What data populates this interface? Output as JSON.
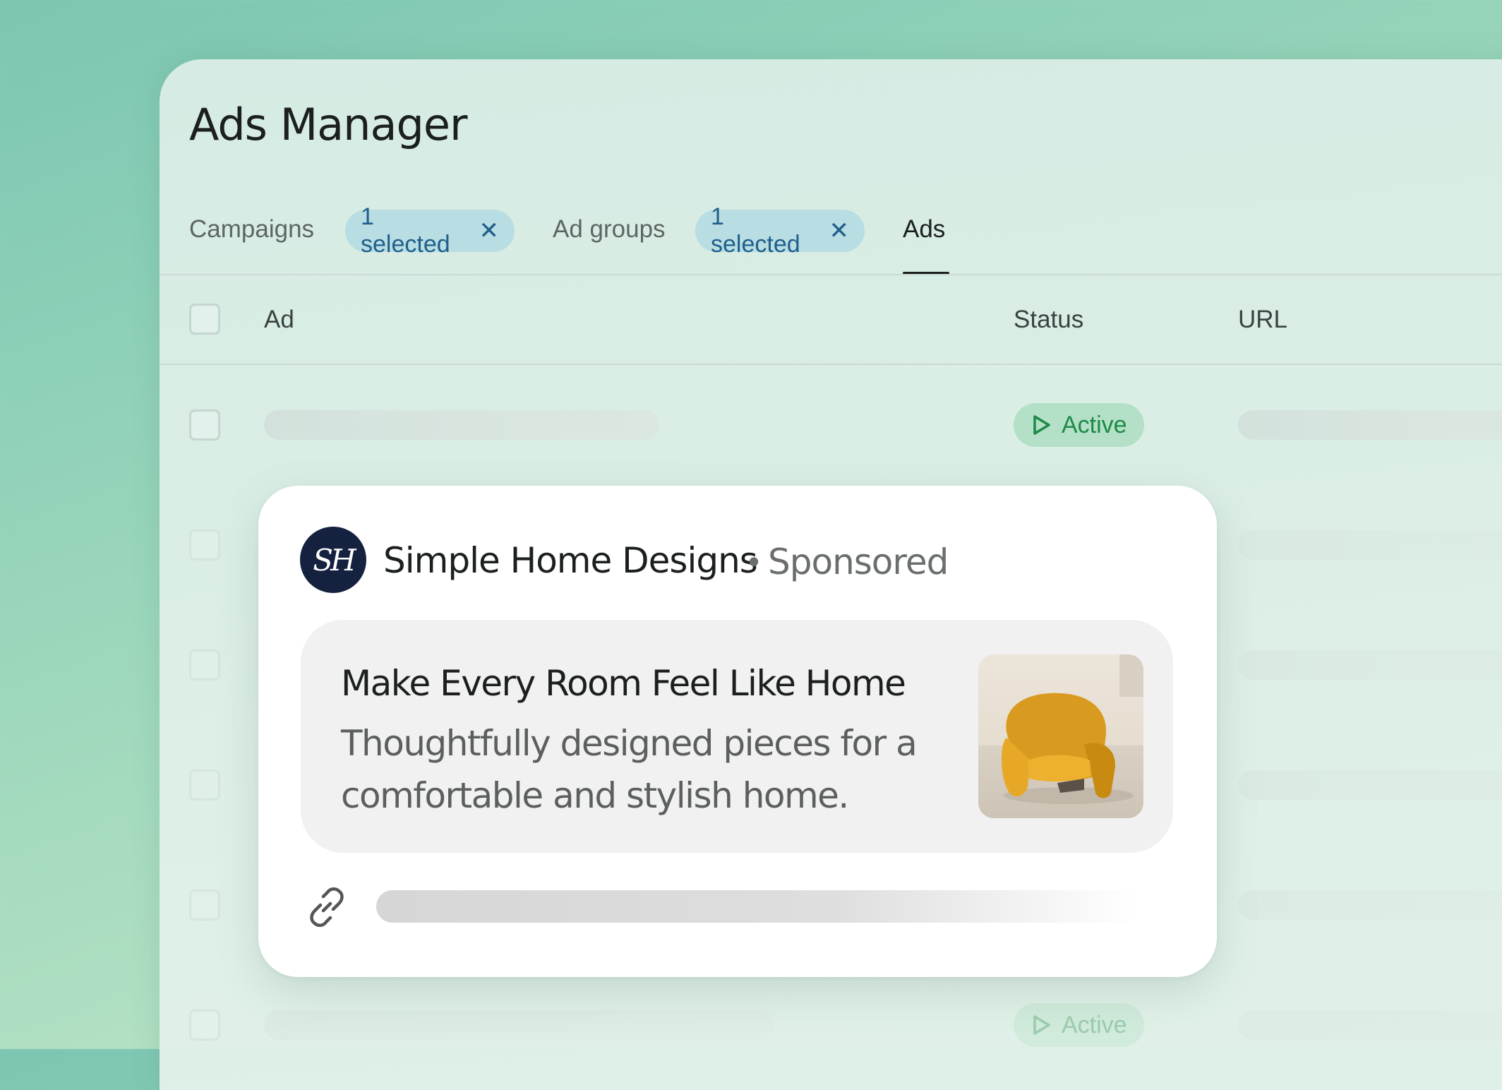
{
  "app": {
    "title": "Ads Manager"
  },
  "tabs": {
    "campaigns": {
      "label": "Campaigns",
      "chip": "1 selected"
    },
    "ad_groups": {
      "label": "Ad groups",
      "chip": "1 selected"
    },
    "ads": {
      "label": "Ads",
      "active": true
    }
  },
  "table": {
    "columns": [
      "Ad",
      "Status",
      "URL"
    ],
    "rows": [
      {
        "status": "Active"
      },
      {
        "status": ""
      },
      {
        "status": ""
      },
      {
        "status": ""
      },
      {
        "status": ""
      },
      {
        "status": "Active"
      }
    ]
  },
  "ad_preview": {
    "advertiser": "Simple Home Designs",
    "separator": "•",
    "sponsored_label": "Sponsored",
    "avatar_initials": "SH",
    "headline": "Make Every Room Feel Like Home",
    "description": "Thoughtfully designed pieces for a comfortable and stylish home.",
    "image": "yellow-armchair",
    "link_icon": "link-icon"
  },
  "colors": {
    "chip_bg": "#b8dde2",
    "chip_text": "#1f5f8c",
    "active_bg": "#b3e0c6",
    "active_text": "#1c8a47",
    "avatar_bg": "#14213f"
  }
}
